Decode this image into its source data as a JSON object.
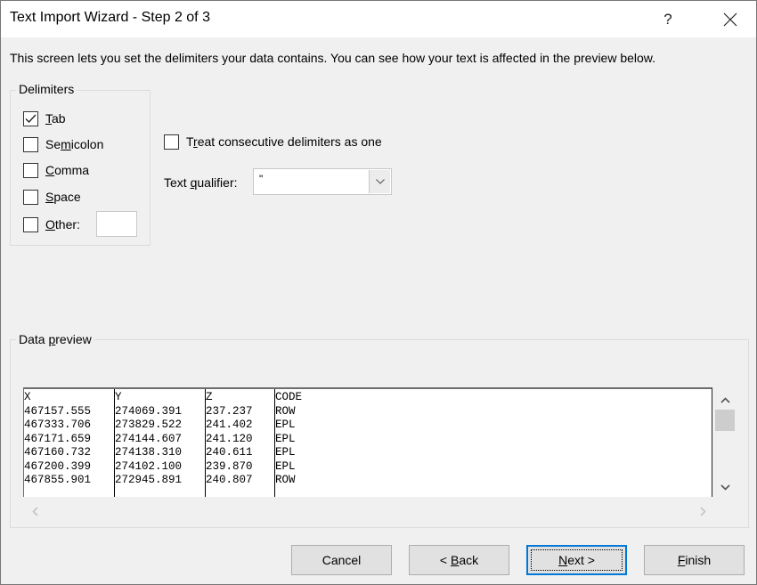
{
  "window": {
    "title": "Text Import Wizard - Step 2 of 3",
    "help_label": "?",
    "close_icon": "close-icon"
  },
  "description": "This screen lets you set the delimiters your data contains.  You can see how your text is affected in the preview below.",
  "delimiters": {
    "group_label": "Delimiters",
    "items": [
      {
        "label": "Tab",
        "mnemonic_index": 0,
        "checked": true
      },
      {
        "label": "Semicolon",
        "mnemonic_index": 2,
        "checked": false
      },
      {
        "label": "Comma",
        "mnemonic_index": 0,
        "checked": false
      },
      {
        "label": "Space",
        "mnemonic_index": 0,
        "checked": false
      },
      {
        "label": "Other:",
        "mnemonic_index": 0,
        "checked": false
      }
    ],
    "other_value": ""
  },
  "options": {
    "treat_consecutive_label": "Treat consecutive delimiters as one",
    "treat_consecutive_checked": false,
    "text_qualifier_label": "Text qualifier:",
    "text_qualifier_value": "\""
  },
  "preview": {
    "group_label": "Data preview",
    "columns": [
      "X",
      "Y",
      "Z",
      "CODE"
    ],
    "rows": [
      [
        "467157.555",
        "274069.391",
        "237.237",
        "ROW"
      ],
      [
        "467333.706",
        "273829.522",
        "241.402",
        "EPL"
      ],
      [
        "467171.659",
        "274144.607",
        "241.120",
        "EPL"
      ],
      [
        "467160.732",
        "274138.310",
        "240.611",
        "EPL"
      ],
      [
        "467200.399",
        "274102.100",
        "239.870",
        "EPL"
      ],
      [
        "467855.901",
        "272945.891",
        "240.807",
        "ROW"
      ]
    ]
  },
  "buttons": {
    "cancel": "Cancel",
    "back": "< Back",
    "next": "Next >",
    "finish": "Finish"
  }
}
